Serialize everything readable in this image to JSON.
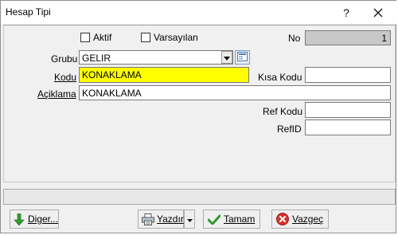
{
  "window": {
    "title": "Hesap Tipi",
    "help_symbol": "?",
    "close_symbol": "×"
  },
  "form": {
    "aktif_label": "Aktif",
    "varsayilan_label": "Varsayılan",
    "no_label": "No",
    "no_value": "1",
    "grubu_label": "Grubu",
    "grubu_value": "GELIR",
    "kodu_label": "Kodu",
    "kodu_value": "KONAKLAMA",
    "kisa_kodu_label": "Kısa Kodu",
    "kisa_kodu_value": "",
    "aciklama_label": "Açiklama",
    "aciklama_value": "KONAKLAMA",
    "ref_kodu_label": "Ref Kodu",
    "ref_kodu_value": "",
    "refid_label": "RefID",
    "refid_value": ""
  },
  "status": {
    "text": ""
  },
  "buttons": {
    "diger": "Diger...",
    "yazdir": "Yazdır",
    "tamam": "Tamam",
    "vazgec": "Vazgeç"
  },
  "colors": {
    "highlight": "#ffff00",
    "no_field": "#c8c8c8",
    "ok_green": "#2e9b2e",
    "cancel_red": "#d9302c"
  },
  "icons": [
    "down-arrow-icon",
    "printer-icon",
    "checkmark-icon",
    "cancel-icon",
    "lookup-icon",
    "chevron-down-icon"
  ]
}
